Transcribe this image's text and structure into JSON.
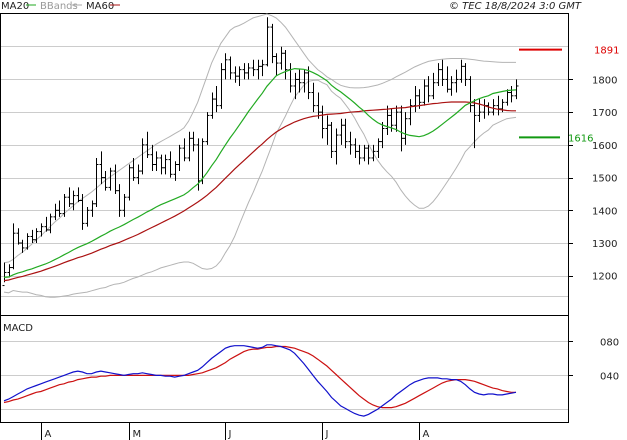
{
  "chart_data": {
    "type": "line",
    "source_label": "© TEC 18/8/2024 3:0 GMT",
    "legend": [
      {
        "label": "MA20",
        "color": "#22aa22"
      },
      {
        "label": "BBands",
        "color": "#aaaaaa"
      },
      {
        "label": "MA60",
        "color": "#aa1111"
      }
    ],
    "price_panel": {
      "ylim": [
        1080,
        2000
      ],
      "y_ticks": [
        1200,
        1300,
        1400,
        1500,
        1600,
        1700,
        1800
      ],
      "y_tick_labels": [
        "1200",
        "1300",
        "1400",
        "1500",
        "1600",
        "1700",
        "1800"
      ],
      "grid": true,
      "levels": [
        {
          "label": "1891",
          "value": 1891,
          "color": "#dd0000"
        },
        {
          "label": "1616",
          "value": 1623,
          "color": "#119911"
        }
      ],
      "ohlc": [
        [
          1170,
          1240,
          1180,
          1210
        ],
        [
          1210,
          1235,
          1195,
          1225
        ],
        [
          1225,
          1360,
          1220,
          1330
        ],
        [
          1330,
          1345,
          1295,
          1300
        ],
        [
          1300,
          1310,
          1270,
          1285
        ],
        [
          1285,
          1330,
          1280,
          1320
        ],
        [
          1320,
          1340,
          1300,
          1310
        ],
        [
          1310,
          1345,
          1300,
          1335
        ],
        [
          1335,
          1360,
          1320,
          1350
        ],
        [
          1350,
          1380,
          1335,
          1340
        ],
        [
          1340,
          1390,
          1330,
          1380
        ],
        [
          1380,
          1420,
          1370,
          1400
        ],
        [
          1400,
          1430,
          1380,
          1390
        ],
        [
          1390,
          1450,
          1380,
          1440
        ],
        [
          1440,
          1470,
          1410,
          1420
        ],
        [
          1420,
          1460,
          1400,
          1445
        ],
        [
          1445,
          1470,
          1425,
          1430
        ],
        [
          1430,
          1450,
          1340,
          1360
        ],
        [
          1360,
          1410,
          1350,
          1400
        ],
        [
          1400,
          1430,
          1380,
          1420
        ],
        [
          1420,
          1560,
          1410,
          1540
        ],
        [
          1540,
          1580,
          1480,
          1500
        ],
        [
          1500,
          1520,
          1460,
          1470
        ],
        [
          1470,
          1530,
          1460,
          1520
        ],
        [
          1520,
          1540,
          1450,
          1460
        ],
        [
          1460,
          1480,
          1380,
          1400
        ],
        [
          1400,
          1450,
          1380,
          1440
        ],
        [
          1440,
          1540,
          1430,
          1530
        ],
        [
          1530,
          1560,
          1490,
          1500
        ],
        [
          1500,
          1540,
          1480,
          1520
        ],
        [
          1520,
          1620,
          1510,
          1600
        ],
        [
          1600,
          1640,
          1560,
          1570
        ],
        [
          1570,
          1600,
          1520,
          1540
        ],
        [
          1540,
          1580,
          1520,
          1560
        ],
        [
          1560,
          1570,
          1510,
          1530
        ],
        [
          1530,
          1570,
          1510,
          1555
        ],
        [
          1555,
          1580,
          1500,
          1510
        ],
        [
          1510,
          1550,
          1490,
          1540
        ],
        [
          1540,
          1600,
          1520,
          1590
        ],
        [
          1590,
          1620,
          1550,
          1560
        ],
        [
          1560,
          1640,
          1550,
          1620
        ],
        [
          1620,
          1640,
          1580,
          1600
        ],
        [
          1600,
          1620,
          1460,
          1490
        ],
        [
          1490,
          1620,
          1480,
          1610
        ],
        [
          1610,
          1700,
          1600,
          1690
        ],
        [
          1690,
          1760,
          1680,
          1740
        ],
        [
          1740,
          1780,
          1700,
          1720
        ],
        [
          1720,
          1850,
          1710,
          1830
        ],
        [
          1830,
          1880,
          1800,
          1860
        ],
        [
          1860,
          1870,
          1800,
          1820
        ],
        [
          1820,
          1840,
          1790,
          1810
        ],
        [
          1810,
          1840,
          1780,
          1830
        ],
        [
          1830,
          1850,
          1800,
          1820
        ],
        [
          1820,
          1850,
          1800,
          1835
        ],
        [
          1835,
          1860,
          1810,
          1830
        ],
        [
          1830,
          1860,
          1800,
          1840
        ],
        [
          1840,
          1860,
          1810,
          1845
        ],
        [
          1845,
          1990,
          1840,
          1960
        ],
        [
          1960,
          1970,
          1850,
          1870
        ],
        [
          1870,
          1880,
          1810,
          1850
        ],
        [
          1850,
          1900,
          1830,
          1880
        ],
        [
          1880,
          1890,
          1800,
          1830
        ],
        [
          1830,
          1850,
          1760,
          1780
        ],
        [
          1780,
          1820,
          1740,
          1800
        ],
        [
          1800,
          1830,
          1760,
          1790
        ],
        [
          1790,
          1830,
          1760,
          1820
        ],
        [
          1820,
          1840,
          1740,
          1760
        ],
        [
          1760,
          1790,
          1700,
          1720
        ],
        [
          1720,
          1760,
          1680,
          1700
        ],
        [
          1700,
          1720,
          1620,
          1650
        ],
        [
          1650,
          1690,
          1600,
          1660
        ],
        [
          1660,
          1670,
          1560,
          1580
        ],
        [
          1580,
          1650,
          1540,
          1630
        ],
        [
          1630,
          1680,
          1600,
          1660
        ],
        [
          1660,
          1680,
          1590,
          1610
        ],
        [
          1610,
          1640,
          1570,
          1600
        ],
        [
          1600,
          1620,
          1560,
          1580
        ],
        [
          1580,
          1600,
          1540,
          1560
        ],
        [
          1560,
          1600,
          1550,
          1590
        ],
        [
          1590,
          1600,
          1540,
          1560
        ],
        [
          1560,
          1600,
          1550,
          1580
        ],
        [
          1580,
          1620,
          1560,
          1610
        ],
        [
          1610,
          1670,
          1590,
          1650
        ],
        [
          1650,
          1720,
          1630,
          1690
        ],
        [
          1690,
          1710,
          1640,
          1660
        ],
        [
          1660,
          1720,
          1640,
          1700
        ],
        [
          1700,
          1720,
          1580,
          1620
        ],
        [
          1620,
          1700,
          1600,
          1680
        ],
        [
          1680,
          1740,
          1660,
          1720
        ],
        [
          1720,
          1780,
          1700,
          1750
        ],
        [
          1750,
          1770,
          1710,
          1730
        ],
        [
          1730,
          1800,
          1720,
          1780
        ],
        [
          1780,
          1810,
          1730,
          1750
        ],
        [
          1750,
          1820,
          1740,
          1790
        ],
        [
          1790,
          1850,
          1780,
          1830
        ],
        [
          1830,
          1860,
          1780,
          1800
        ],
        [
          1800,
          1840,
          1760,
          1770
        ],
        [
          1770,
          1810,
          1750,
          1790
        ],
        [
          1790,
          1830,
          1760,
          1800
        ],
        [
          1800,
          1860,
          1790,
          1840
        ],
        [
          1840,
          1850,
          1780,
          1800
        ],
        [
          1800,
          1810,
          1700,
          1720
        ],
        [
          1720,
          1740,
          1590,
          1690
        ],
        [
          1690,
          1740,
          1670,
          1700
        ],
        [
          1700,
          1740,
          1680,
          1720
        ],
        [
          1720,
          1730,
          1690,
          1700
        ],
        [
          1700,
          1740,
          1690,
          1720
        ],
        [
          1720,
          1750,
          1690,
          1710
        ],
        [
          1710,
          1740,
          1700,
          1730
        ],
        [
          1730,
          1770,
          1720,
          1760
        ],
        [
          1760,
          1780,
          1730,
          1750
        ],
        [
          1750,
          1800,
          1740,
          1780
        ]
      ],
      "ma20": [
        1195,
        1196,
        1203,
        1208,
        1212,
        1217,
        1221,
        1226,
        1231,
        1236,
        1242,
        1249,
        1256,
        1264,
        1271,
        1279,
        1286,
        1292,
        1298,
        1305,
        1313,
        1321,
        1328,
        1336,
        1343,
        1349,
        1356,
        1364,
        1372,
        1379,
        1387,
        1395,
        1402,
        1410,
        1417,
        1423,
        1429,
        1435,
        1441,
        1447,
        1457,
        1469,
        1480,
        1496,
        1515,
        1536,
        1555,
        1578,
        1600,
        1621,
        1640,
        1660,
        1681,
        1702,
        1721,
        1740,
        1758,
        1779,
        1795,
        1811,
        1818,
        1824,
        1829,
        1833,
        1832,
        1831,
        1827,
        1821,
        1814,
        1805,
        1796,
        1782,
        1771,
        1762,
        1751,
        1740,
        1728,
        1715,
        1704,
        1690,
        1678,
        1668,
        1661,
        1656,
        1652,
        1647,
        1639,
        1633,
        1629,
        1627,
        1625,
        1628,
        1634,
        1642,
        1652,
        1663,
        1674,
        1685,
        1696,
        1708,
        1721,
        1728,
        1735,
        1741,
        1746,
        1750,
        1757,
        1760,
        1763,
        1766,
        1767,
        1768
      ],
      "ma60": [
        1185,
        1187,
        1191,
        1195,
        1198,
        1202,
        1206,
        1210,
        1214,
        1219,
        1224,
        1229,
        1234,
        1240,
        1245,
        1250,
        1255,
        1259,
        1264,
        1269,
        1275,
        1281,
        1286,
        1292,
        1297,
        1302,
        1308,
        1314,
        1320,
        1326,
        1333,
        1340,
        1347,
        1354,
        1361,
        1368,
        1375,
        1382,
        1390,
        1398,
        1407,
        1416,
        1425,
        1435,
        1446,
        1458,
        1470,
        1484,
        1498,
        1512,
        1526,
        1539,
        1552,
        1565,
        1578,
        1591,
        1603,
        1616,
        1628,
        1639,
        1648,
        1656,
        1663,
        1670,
        1675,
        1680,
        1684,
        1687,
        1689,
        1691,
        1693,
        1694,
        1695,
        1696,
        1698,
        1700,
        1701,
        1702,
        1704,
        1705,
        1706,
        1707,
        1708,
        1709,
        1711,
        1712,
        1713,
        1714,
        1716,
        1718,
        1720,
        1722,
        1724,
        1726,
        1727,
        1729,
        1730,
        1731,
        1731,
        1731,
        1731,
        1730,
        1728,
        1725,
        1721,
        1716,
        1712,
        1709,
        1707,
        1705,
        1704,
        1704
      ],
      "bb_upper": [
        1240,
        1242,
        1250,
        1262,
        1272,
        1284,
        1296,
        1310,
        1322,
        1336,
        1350,
        1364,
        1376,
        1390,
        1402,
        1414,
        1426,
        1436,
        1446,
        1456,
        1468,
        1480,
        1492,
        1502,
        1512,
        1522,
        1532,
        1542,
        1552,
        1562,
        1572,
        1582,
        1592,
        1602,
        1610,
        1618,
        1626,
        1634,
        1642,
        1652,
        1672,
        1700,
        1730,
        1770,
        1810,
        1850,
        1880,
        1910,
        1930,
        1950,
        1960,
        1965,
        1972,
        1980,
        1988,
        1992,
        1996,
        2000,
        1995,
        1988,
        1975,
        1960,
        1940,
        1920,
        1900,
        1880,
        1860,
        1845,
        1830,
        1820,
        1808,
        1800,
        1790,
        1782,
        1778,
        1775,
        1774,
        1774,
        1775,
        1777,
        1780,
        1783,
        1788,
        1794,
        1800,
        1808,
        1815,
        1822,
        1830,
        1838,
        1844,
        1850,
        1855,
        1858,
        1860,
        1862,
        1863,
        1864,
        1864,
        1864,
        1863,
        1862,
        1860,
        1858,
        1856,
        1855,
        1854,
        1853,
        1852,
        1852,
        1852,
        1852
      ],
      "bb_lower": [
        1150,
        1148,
        1155,
        1152,
        1150,
        1150,
        1146,
        1142,
        1140,
        1136,
        1134,
        1134,
        1136,
        1138,
        1140,
        1144,
        1146,
        1148,
        1150,
        1154,
        1158,
        1162,
        1164,
        1170,
        1174,
        1176,
        1180,
        1186,
        1192,
        1196,
        1202,
        1208,
        1212,
        1218,
        1224,
        1228,
        1232,
        1236,
        1240,
        1242,
        1242,
        1238,
        1230,
        1222,
        1220,
        1222,
        1230,
        1246,
        1270,
        1292,
        1320,
        1355,
        1390,
        1424,
        1454,
        1488,
        1520,
        1558,
        1595,
        1634,
        1661,
        1688,
        1718,
        1746,
        1764,
        1782,
        1794,
        1797,
        1798,
        1790,
        1784,
        1764,
        1752,
        1742,
        1724,
        1705,
        1682,
        1656,
        1633,
        1603,
        1576,
        1553,
        1534,
        1518,
        1504,
        1486,
        1463,
        1444,
        1428,
        1416,
        1406,
        1406,
        1413,
        1426,
        1444,
        1464,
        1485,
        1506,
        1528,
        1552,
        1579,
        1594,
        1610,
        1624,
        1636,
        1645,
        1660,
        1667,
        1674,
        1680,
        1682,
        1684
      ]
    },
    "macd_panel": {
      "label": "MACD",
      "ylim": [
        -15,
        110
      ],
      "y_ticks": [
        40,
        80
      ],
      "y_tick_labels": [
        "040",
        "080"
      ],
      "grid": true,
      "macd": [
        10,
        12,
        15,
        18,
        21,
        24,
        26,
        28,
        30,
        32,
        34,
        36,
        38,
        40,
        42,
        44,
        45,
        44,
        42,
        42,
        44,
        45,
        44,
        43,
        42,
        41,
        40,
        41,
        42,
        42,
        43,
        42,
        41,
        40,
        40,
        39,
        39,
        38,
        39,
        40,
        42,
        44,
        46,
        50,
        55,
        60,
        64,
        68,
        72,
        74,
        75,
        75,
        75,
        74,
        73,
        72,
        73,
        76,
        76,
        75,
        74,
        72,
        70,
        66,
        60,
        54,
        47,
        40,
        33,
        27,
        21,
        14,
        9,
        4,
        1,
        -2,
        -5,
        -7,
        -8,
        -6,
        -3,
        0,
        4,
        8,
        12,
        17,
        21,
        25,
        29,
        32,
        34,
        36,
        37,
        37,
        37,
        36,
        36,
        35,
        35,
        33,
        29,
        24,
        20,
        18,
        17,
        18,
        18,
        17,
        17,
        18,
        19,
        20
      ],
      "signal": [
        8,
        9,
        11,
        12,
        14,
        16,
        18,
        20,
        21,
        23,
        25,
        27,
        29,
        30,
        32,
        33,
        35,
        36,
        37,
        38,
        38,
        39,
        39,
        40,
        40,
        40,
        40,
        40,
        40,
        40,
        40,
        40,
        40,
        40,
        40,
        40,
        40,
        40,
        40,
        40,
        40,
        41,
        42,
        43,
        45,
        47,
        49,
        52,
        55,
        59,
        62,
        65,
        68,
        70,
        71,
        71,
        72,
        73,
        73,
        74,
        74,
        74,
        73,
        72,
        70,
        68,
        66,
        63,
        59,
        55,
        51,
        46,
        41,
        36,
        31,
        26,
        21,
        16,
        12,
        8,
        5,
        3,
        2,
        2,
        2,
        3,
        5,
        7,
        10,
        13,
        16,
        19,
        22,
        25,
        28,
        31,
        33,
        34,
        35,
        35,
        35,
        34,
        33,
        31,
        29,
        27,
        25,
        24,
        22,
        21,
        20,
        20
      ]
    },
    "x_axis": {
      "tick_labels": [
        "A",
        "M",
        "J",
        "J",
        "A"
      ],
      "tick_index": [
        8,
        27,
        48,
        69,
        90
      ]
    }
  }
}
